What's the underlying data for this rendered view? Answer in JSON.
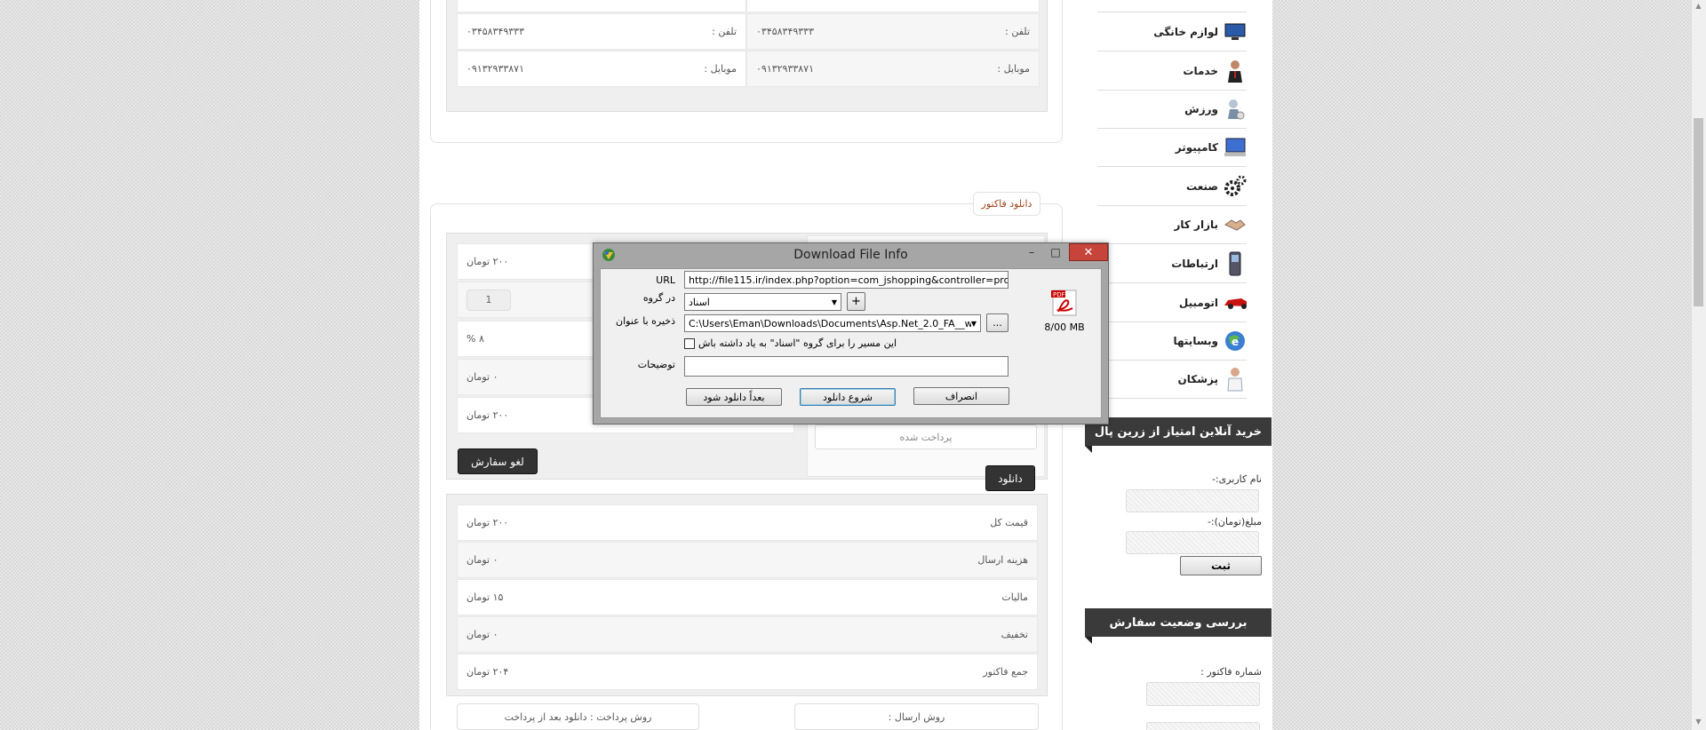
{
  "top_table": {
    "rows": [
      {
        "label_right": "تلفن :",
        "value_right": "۰۳۴۵۸۳۴۹۳۳۳",
        "label_left": "تلفن :",
        "value_left": "۰۳۴۵۸۳۴۹۳۳۳"
      },
      {
        "label_right": "موبایل :",
        "value_right": "۰۹۱۳۲۹۳۳۸۷۱",
        "label_left": "موبایل :",
        "value_left": "۰۹۱۳۲۹۳۳۸۷۱"
      }
    ]
  },
  "invoice": {
    "tab_label": "دانلود فاکتور",
    "product_values": [
      "۲۰۰ تومان",
      "1",
      "۸ %",
      "۰ تومان",
      "۲۰۰ تومان"
    ],
    "paid_label": "پرداخت شده",
    "download_button": "دانلود",
    "cancel_order_button": "لغو سفارش",
    "totals": [
      {
        "label": "قیمت کل",
        "value": "۲۰۰ تومان"
      },
      {
        "label": "هزینه ارسال",
        "value": "۰ تومان"
      },
      {
        "label": "مالیات",
        "value": "۱۵ تومان"
      },
      {
        "label": "تخفیف",
        "value": "۰ تومان"
      },
      {
        "label": "جمع فاکتور",
        "value": "۲۰۴ تومان"
      }
    ],
    "shipping_method": "روش ارسال :",
    "payment_method": "روش پرداخت : دانلود بعد از پرداخت"
  },
  "sidebar": {
    "categories": [
      {
        "label": "لوازم خانگی",
        "icon": "monitor-icon"
      },
      {
        "label": "خدمات",
        "icon": "person-icon"
      },
      {
        "label": "ورزش",
        "icon": "athlete-icon"
      },
      {
        "label": "کامپیوتر",
        "icon": "computer-icon"
      },
      {
        "label": "صنعت",
        "icon": "gears-icon"
      },
      {
        "label": "بازار کار",
        "icon": "handshake-icon"
      },
      {
        "label": "ارتباطات",
        "icon": "phone-icon"
      },
      {
        "label": "اتومبیل",
        "icon": "car-icon"
      },
      {
        "label": "وبسایتها",
        "icon": "globe-icon"
      },
      {
        "label": "پزشکان",
        "icon": "doctor-icon"
      }
    ],
    "zarinpal": {
      "title": "خرید آنلاین امتیاز از زرین پال",
      "username_label": "نام کاربری:-",
      "amount_label": "مبلغ(تومان):-",
      "submit": "ثبت"
    },
    "order_status": {
      "title": "بررسی وضعیت سفارش",
      "invoice_number_label": "شماره فاکتور :"
    }
  },
  "dialog": {
    "title": "Download File Info",
    "url_label": "URL",
    "url_value": "http://file115.ir/index.php?option=com_jshopping&controller=product&task",
    "group_label": "در گروه",
    "group_value": "اسناد",
    "add_group": "+",
    "save_as_label": "ذخیره با عنوان",
    "save_path": "C:\\Users\\Eman\\Downloads\\Documents\\Asp.Net_2.0_FA__www.",
    "browse": "...",
    "remember_label": "این مسیر را برای گروه \"اسناد\" به یاد داشته باش",
    "description_label": "توضیحات",
    "description_value": "",
    "file_size": "8/00  MB",
    "file_icon": "pdf-icon",
    "cancel_button": "انصراف",
    "start_button": "شروع دانلود",
    "later_button": "بعداً دانلود شود",
    "accent": "#c7443a"
  }
}
